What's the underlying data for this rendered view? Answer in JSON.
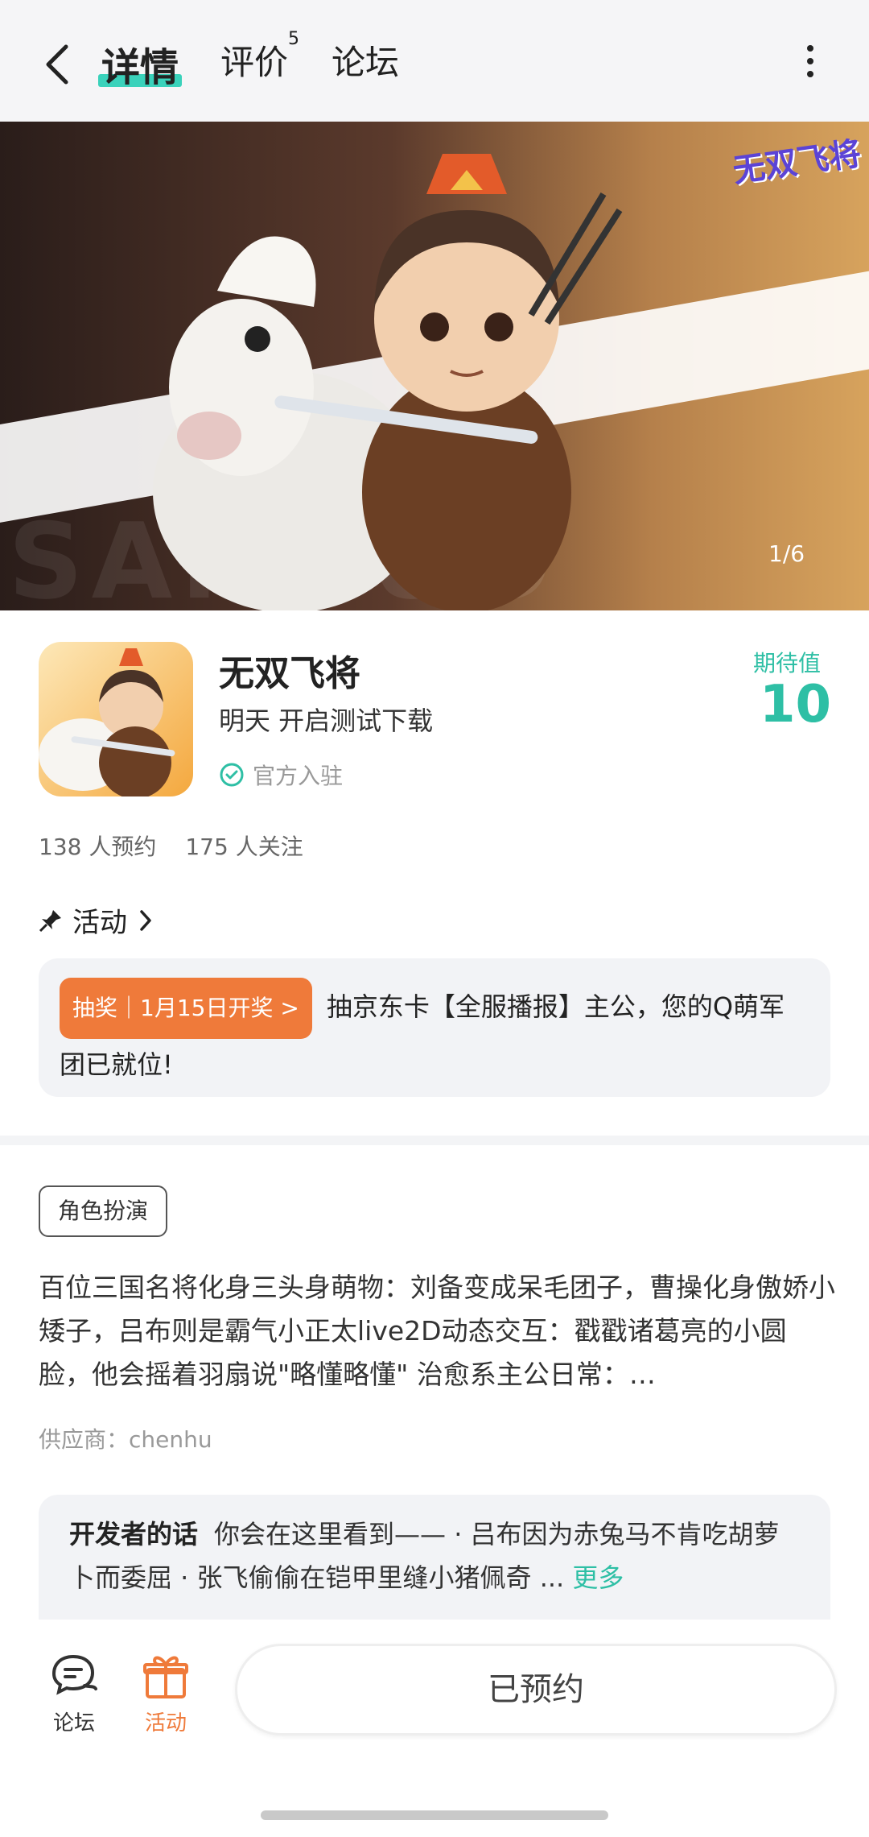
{
  "nav": {
    "tabs": [
      {
        "label": "详情",
        "active": true
      },
      {
        "label": "评价",
        "badge": "5"
      },
      {
        "label": "论坛"
      }
    ]
  },
  "banner": {
    "logo_text": "无双飞将",
    "watermark": "SANGUO",
    "counter": "1/6"
  },
  "game": {
    "title": "无双飞将",
    "subtitle": "明天 开启测试下载",
    "official": "官方入驻",
    "expect_label": "期待值",
    "expect_value": "10",
    "reservations": "138 人预约",
    "follows": "175 人关注"
  },
  "activity": {
    "heading": "活动",
    "pill": "抽奖｜1月15日开奖 >",
    "text": "抽京东卡【全服播报】主公，您的Q萌军团已就位!"
  },
  "details": {
    "tag": "角色扮演",
    "intro": "百位三国名将化身三头身萌物：刘备变成呆毛团子，曹操化身傲娇小矮子，吕布则是霸气小正太live2D动态交互：戳戳诸葛亮的小圆脸，他会摇着羽扇说\"略懂略懂\" 治愈系主公日常：…",
    "supplier": "供应商：chenhu"
  },
  "developer": {
    "label": "开发者的话",
    "text": "你会在这里看到——  · 吕布因为赤兔马不肯吃胡萝卜而委屈  · 张飞偷偷在铠甲里缝小猪佩奇 ...",
    "more": "更多"
  },
  "bottom": {
    "forum": "论坛",
    "activity": "活动",
    "button": "已预约"
  },
  "colors": {
    "accent": "#2ebfa5",
    "orange": "#ef7a3a"
  }
}
